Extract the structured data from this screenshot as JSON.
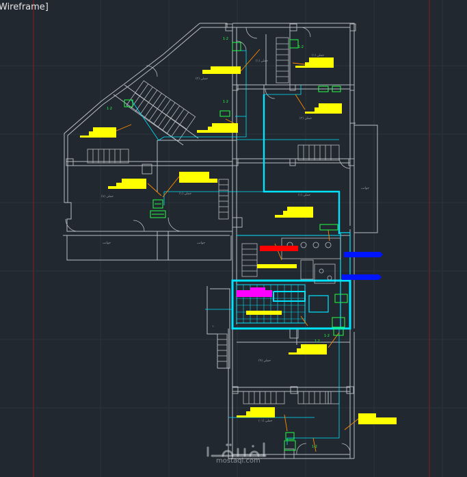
{
  "viewport": {
    "view_label": "Wireframe]",
    "background": "#212830"
  },
  "drawing": {
    "colors": {
      "walls": "#b9bec4",
      "guides": "#7a1f1f",
      "grid": "#2b333c",
      "pipes_cyan": "#00e5ff",
      "leaders": "#ff8c00",
      "tags_yellow": "#ffff00",
      "equipment_green": "#22ff44",
      "pipe_blue": "#0015ff",
      "pipe_red": "#ff0000",
      "magenta": "#ff00ff"
    }
  },
  "watermark": {
    "logo_text": "مستقل",
    "url": "mostaql.com"
  }
}
